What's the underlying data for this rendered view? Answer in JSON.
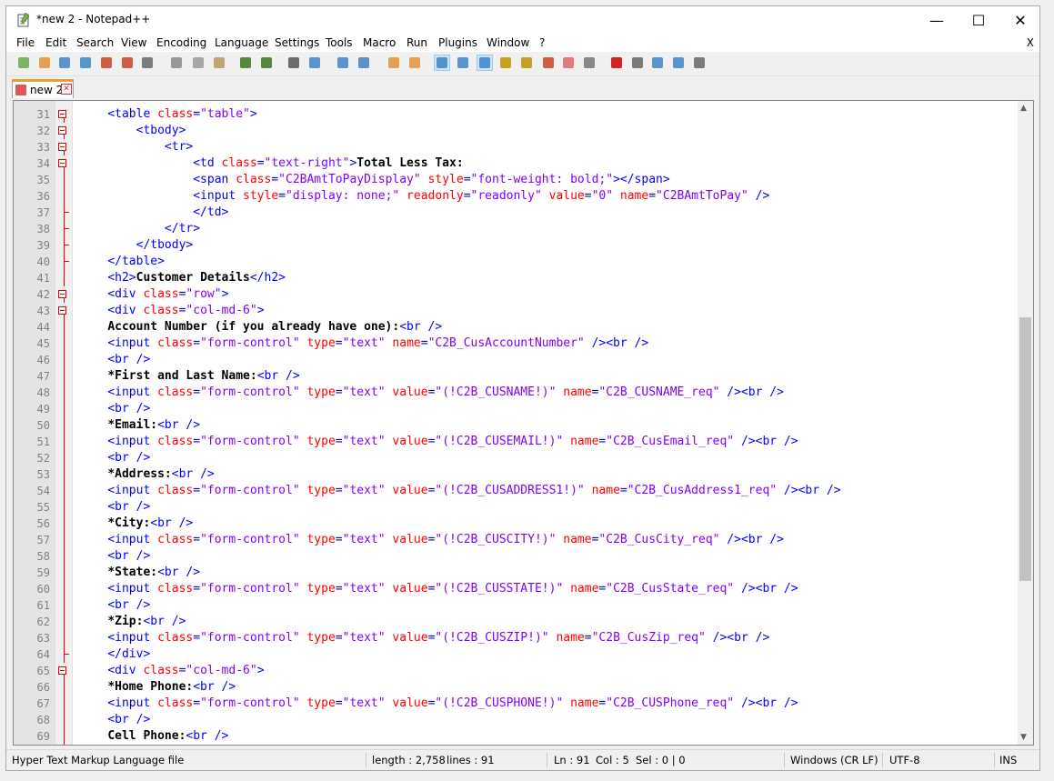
{
  "window": {
    "title": "*new 2 - Notepad++",
    "min_glyph": "—",
    "max_glyph": "☐",
    "close_glyph": "✕"
  },
  "menu": {
    "items": [
      "File",
      "Edit",
      "Search",
      "View",
      "Encoding",
      "Language",
      "Settings",
      "Tools",
      "Macro",
      "Run",
      "Plugins",
      "Window",
      "?"
    ],
    "close_doc": "X"
  },
  "toolbar": {
    "icons": [
      "new-file-icon",
      "open-file-icon",
      "save-icon",
      "save-all-icon",
      "close-icon",
      "close-all-icon",
      "print-icon",
      "cut-icon",
      "copy-icon",
      "paste-icon",
      "undo-icon",
      "redo-icon",
      "find-icon",
      "replace-icon",
      "zoom-in-icon",
      "zoom-out-icon",
      "sync-vertical-icon",
      "sync-horizontal-icon",
      "word-wrap-icon",
      "show-all-chars-icon",
      "indent-guide-icon",
      "language-udl-icon",
      "doc-map-icon",
      "function-list-icon",
      "folder-workspace-icon",
      "monitoring-icon",
      "record-macro-icon",
      "stop-record-icon",
      "play-macro-icon",
      "run-multiple-icon",
      "save-macro-icon"
    ]
  },
  "tab": {
    "label": "new 2"
  },
  "editor": {
    "lines": [
      {
        "n": "31",
        "fold": "box",
        "segs": [
          [
            "    ",
            "p"
          ],
          [
            "<table ",
            "t"
          ],
          [
            "class",
            "a"
          ],
          [
            "=",
            "t"
          ],
          [
            "\"table\"",
            "v"
          ],
          [
            ">",
            "t"
          ]
        ]
      },
      {
        "n": "32",
        "fold": "box",
        "segs": [
          [
            "        ",
            "p"
          ],
          [
            "<tbody>",
            "t"
          ]
        ]
      },
      {
        "n": "33",
        "fold": "box",
        "segs": [
          [
            "            ",
            "p"
          ],
          [
            "<tr>",
            "t"
          ]
        ]
      },
      {
        "n": "34",
        "fold": "box",
        "segs": [
          [
            "                ",
            "p"
          ],
          [
            "<td ",
            "t"
          ],
          [
            "class",
            "a"
          ],
          [
            "=",
            "t"
          ],
          [
            "\"text-right\"",
            "v"
          ],
          [
            ">",
            "t"
          ],
          [
            "Total Less Tax:",
            "b"
          ]
        ]
      },
      {
        "n": "35",
        "fold": "line",
        "segs": [
          [
            "                ",
            "p"
          ],
          [
            "<span ",
            "t"
          ],
          [
            "class",
            "a"
          ],
          [
            "=",
            "t"
          ],
          [
            "\"C2BAmtToPayDisplay\"",
            "v"
          ],
          [
            " style",
            "a"
          ],
          [
            "=",
            "t"
          ],
          [
            "\"font-weight: bold;\"",
            "v"
          ],
          [
            "></span>",
            "t"
          ]
        ]
      },
      {
        "n": "36",
        "fold": "line",
        "segs": [
          [
            "                ",
            "p"
          ],
          [
            "<input ",
            "t"
          ],
          [
            "style",
            "a"
          ],
          [
            "=",
            "t"
          ],
          [
            "\"display: none;\"",
            "v"
          ],
          [
            " readonly",
            "a"
          ],
          [
            "=",
            "t"
          ],
          [
            "\"readonly\"",
            "v"
          ],
          [
            " value",
            "a"
          ],
          [
            "=",
            "t"
          ],
          [
            "\"0\"",
            "v"
          ],
          [
            " name",
            "a"
          ],
          [
            "=",
            "t"
          ],
          [
            "\"C2BAmtToPay\"",
            "v"
          ],
          [
            " />",
            "t"
          ]
        ]
      },
      {
        "n": "37",
        "fold": "end",
        "segs": [
          [
            "                ",
            "p"
          ],
          [
            "</td>",
            "t"
          ]
        ]
      },
      {
        "n": "38",
        "fold": "end",
        "segs": [
          [
            "            ",
            "p"
          ],
          [
            "</tr>",
            "t"
          ]
        ]
      },
      {
        "n": "39",
        "fold": "end",
        "segs": [
          [
            "        ",
            "p"
          ],
          [
            "</tbody>",
            "t"
          ]
        ]
      },
      {
        "n": "40",
        "fold": "end",
        "segs": [
          [
            "    ",
            "p"
          ],
          [
            "</table>",
            "t"
          ]
        ]
      },
      {
        "n": "41",
        "fold": "line",
        "segs": [
          [
            "    ",
            "p"
          ],
          [
            "<h2>",
            "t"
          ],
          [
            "Customer Details",
            "b"
          ],
          [
            "</h2>",
            "t"
          ]
        ]
      },
      {
        "n": "42",
        "fold": "box",
        "segs": [
          [
            "    ",
            "p"
          ],
          [
            "<div ",
            "t"
          ],
          [
            "class",
            "a"
          ],
          [
            "=",
            "t"
          ],
          [
            "\"row\"",
            "v"
          ],
          [
            ">",
            "t"
          ]
        ]
      },
      {
        "n": "43",
        "fold": "box",
        "segs": [
          [
            "    ",
            "p"
          ],
          [
            "<div ",
            "t"
          ],
          [
            "class",
            "a"
          ],
          [
            "=",
            "t"
          ],
          [
            "\"col-md-6\"",
            "v"
          ],
          [
            ">",
            "t"
          ]
        ]
      },
      {
        "n": "44",
        "fold": "line",
        "segs": [
          [
            "    ",
            "p"
          ],
          [
            "Account Number (if you already have one):",
            "b"
          ],
          [
            "<br />",
            "t"
          ]
        ]
      },
      {
        "n": "45",
        "fold": "line",
        "segs": [
          [
            "    ",
            "p"
          ],
          [
            "<input ",
            "t"
          ],
          [
            "class",
            "a"
          ],
          [
            "=",
            "t"
          ],
          [
            "\"form-control\"",
            "v"
          ],
          [
            " type",
            "a"
          ],
          [
            "=",
            "t"
          ],
          [
            "\"text\"",
            "v"
          ],
          [
            " name",
            "a"
          ],
          [
            "=",
            "t"
          ],
          [
            "\"C2B_CusAccountNumber\"",
            "v"
          ],
          [
            " /><br />",
            "t"
          ]
        ]
      },
      {
        "n": "46",
        "fold": "line",
        "segs": [
          [
            "    ",
            "p"
          ],
          [
            "<br />",
            "t"
          ]
        ]
      },
      {
        "n": "47",
        "fold": "line",
        "segs": [
          [
            "    ",
            "p"
          ],
          [
            "*First and Last Name:",
            "b"
          ],
          [
            "<br />",
            "t"
          ]
        ]
      },
      {
        "n": "48",
        "fold": "line",
        "segs": [
          [
            "    ",
            "p"
          ],
          [
            "<input ",
            "t"
          ],
          [
            "class",
            "a"
          ],
          [
            "=",
            "t"
          ],
          [
            "\"form-control\"",
            "v"
          ],
          [
            " type",
            "a"
          ],
          [
            "=",
            "t"
          ],
          [
            "\"text\"",
            "v"
          ],
          [
            " value",
            "a"
          ],
          [
            "=",
            "t"
          ],
          [
            "\"(!C2B_CUSNAME!)\"",
            "v"
          ],
          [
            " name",
            "a"
          ],
          [
            "=",
            "t"
          ],
          [
            "\"C2B_CUSNAME_req\"",
            "v"
          ],
          [
            " /><br />",
            "t"
          ]
        ]
      },
      {
        "n": "49",
        "fold": "line",
        "segs": [
          [
            "    ",
            "p"
          ],
          [
            "<br />",
            "t"
          ]
        ]
      },
      {
        "n": "50",
        "fold": "line",
        "segs": [
          [
            "    ",
            "p"
          ],
          [
            "*Email:",
            "b"
          ],
          [
            "<br />",
            "t"
          ]
        ]
      },
      {
        "n": "51",
        "fold": "line",
        "segs": [
          [
            "    ",
            "p"
          ],
          [
            "<input ",
            "t"
          ],
          [
            "class",
            "a"
          ],
          [
            "=",
            "t"
          ],
          [
            "\"form-control\"",
            "v"
          ],
          [
            " type",
            "a"
          ],
          [
            "=",
            "t"
          ],
          [
            "\"text\"",
            "v"
          ],
          [
            " value",
            "a"
          ],
          [
            "=",
            "t"
          ],
          [
            "\"(!C2B_CUSEMAIL!)\"",
            "v"
          ],
          [
            " name",
            "a"
          ],
          [
            "=",
            "t"
          ],
          [
            "\"C2B_CusEmail_req\"",
            "v"
          ],
          [
            " /><br />",
            "t"
          ]
        ]
      },
      {
        "n": "52",
        "fold": "line",
        "segs": [
          [
            "    ",
            "p"
          ],
          [
            "<br />",
            "t"
          ]
        ]
      },
      {
        "n": "53",
        "fold": "line",
        "segs": [
          [
            "    ",
            "p"
          ],
          [
            "*Address:",
            "b"
          ],
          [
            "<br />",
            "t"
          ]
        ]
      },
      {
        "n": "54",
        "fold": "line",
        "segs": [
          [
            "    ",
            "p"
          ],
          [
            "<input ",
            "t"
          ],
          [
            "class",
            "a"
          ],
          [
            "=",
            "t"
          ],
          [
            "\"form-control\"",
            "v"
          ],
          [
            " type",
            "a"
          ],
          [
            "=",
            "t"
          ],
          [
            "\"text\"",
            "v"
          ],
          [
            " value",
            "a"
          ],
          [
            "=",
            "t"
          ],
          [
            "\"(!C2B_CUSADDRESS1!)\"",
            "v"
          ],
          [
            " name",
            "a"
          ],
          [
            "=",
            "t"
          ],
          [
            "\"C2B_CusAddress1_req\"",
            "v"
          ],
          [
            " /><br />",
            "t"
          ]
        ]
      },
      {
        "n": "55",
        "fold": "line",
        "segs": [
          [
            "    ",
            "p"
          ],
          [
            "<br />",
            "t"
          ]
        ]
      },
      {
        "n": "56",
        "fold": "line",
        "segs": [
          [
            "    ",
            "p"
          ],
          [
            "*City:",
            "b"
          ],
          [
            "<br />",
            "t"
          ]
        ]
      },
      {
        "n": "57",
        "fold": "line",
        "segs": [
          [
            "    ",
            "p"
          ],
          [
            "<input ",
            "t"
          ],
          [
            "class",
            "a"
          ],
          [
            "=",
            "t"
          ],
          [
            "\"form-control\"",
            "v"
          ],
          [
            " type",
            "a"
          ],
          [
            "=",
            "t"
          ],
          [
            "\"text\"",
            "v"
          ],
          [
            " value",
            "a"
          ],
          [
            "=",
            "t"
          ],
          [
            "\"(!C2B_CUSCITY!)\"",
            "v"
          ],
          [
            " name",
            "a"
          ],
          [
            "=",
            "t"
          ],
          [
            "\"C2B_CusCity_req\"",
            "v"
          ],
          [
            " /><br />",
            "t"
          ]
        ]
      },
      {
        "n": "58",
        "fold": "line",
        "segs": [
          [
            "    ",
            "p"
          ],
          [
            "<br />",
            "t"
          ]
        ]
      },
      {
        "n": "59",
        "fold": "line",
        "segs": [
          [
            "    ",
            "p"
          ],
          [
            "*State:",
            "b"
          ],
          [
            "<br />",
            "t"
          ]
        ]
      },
      {
        "n": "60",
        "fold": "line",
        "segs": [
          [
            "    ",
            "p"
          ],
          [
            "<input ",
            "t"
          ],
          [
            "class",
            "a"
          ],
          [
            "=",
            "t"
          ],
          [
            "\"form-control\"",
            "v"
          ],
          [
            " type",
            "a"
          ],
          [
            "=",
            "t"
          ],
          [
            "\"text\"",
            "v"
          ],
          [
            " value",
            "a"
          ],
          [
            "=",
            "t"
          ],
          [
            "\"(!C2B_CUSSTATE!)\"",
            "v"
          ],
          [
            " name",
            "a"
          ],
          [
            "=",
            "t"
          ],
          [
            "\"C2B_CusState_req\"",
            "v"
          ],
          [
            " /><br />",
            "t"
          ]
        ]
      },
      {
        "n": "61",
        "fold": "line",
        "segs": [
          [
            "    ",
            "p"
          ],
          [
            "<br />",
            "t"
          ]
        ]
      },
      {
        "n": "62",
        "fold": "line",
        "segs": [
          [
            "    ",
            "p"
          ],
          [
            "*Zip:",
            "b"
          ],
          [
            "<br />",
            "t"
          ]
        ]
      },
      {
        "n": "63",
        "fold": "line",
        "segs": [
          [
            "    ",
            "p"
          ],
          [
            "<input ",
            "t"
          ],
          [
            "class",
            "a"
          ],
          [
            "=",
            "t"
          ],
          [
            "\"form-control\"",
            "v"
          ],
          [
            " type",
            "a"
          ],
          [
            "=",
            "t"
          ],
          [
            "\"text\"",
            "v"
          ],
          [
            " value",
            "a"
          ],
          [
            "=",
            "t"
          ],
          [
            "\"(!C2B_CUSZIP!)\"",
            "v"
          ],
          [
            " name",
            "a"
          ],
          [
            "=",
            "t"
          ],
          [
            "\"C2B_CusZip_req\"",
            "v"
          ],
          [
            " /><br />",
            "t"
          ]
        ]
      },
      {
        "n": "64",
        "fold": "end",
        "segs": [
          [
            "    ",
            "p"
          ],
          [
            "</div>",
            "t"
          ]
        ]
      },
      {
        "n": "65",
        "fold": "box",
        "segs": [
          [
            "    ",
            "p"
          ],
          [
            "<div ",
            "t"
          ],
          [
            "class",
            "a"
          ],
          [
            "=",
            "t"
          ],
          [
            "\"col-md-6\"",
            "v"
          ],
          [
            ">",
            "t"
          ]
        ]
      },
      {
        "n": "66",
        "fold": "line",
        "segs": [
          [
            "    ",
            "p"
          ],
          [
            "*Home Phone:",
            "b"
          ],
          [
            "<br />",
            "t"
          ]
        ]
      },
      {
        "n": "67",
        "fold": "line",
        "segs": [
          [
            "    ",
            "p"
          ],
          [
            "<input ",
            "t"
          ],
          [
            "class",
            "a"
          ],
          [
            "=",
            "t"
          ],
          [
            "\"form-control\"",
            "v"
          ],
          [
            " type",
            "a"
          ],
          [
            "=",
            "t"
          ],
          [
            "\"text\"",
            "v"
          ],
          [
            " value",
            "a"
          ],
          [
            "=",
            "t"
          ],
          [
            "\"(!C2B_CUSPHONE!)\"",
            "v"
          ],
          [
            " name",
            "a"
          ],
          [
            "=",
            "t"
          ],
          [
            "\"C2B_CUSPhone_req\"",
            "v"
          ],
          [
            " /><br />",
            "t"
          ]
        ]
      },
      {
        "n": "68",
        "fold": "line",
        "segs": [
          [
            "    ",
            "p"
          ],
          [
            "<br />",
            "t"
          ]
        ]
      },
      {
        "n": "69",
        "fold": "line",
        "segs": [
          [
            "    ",
            "p"
          ],
          [
            "Cell Phone:",
            "b"
          ],
          [
            "<br />",
            "t"
          ]
        ]
      }
    ]
  },
  "scroll": {
    "up_glyph": "▲",
    "down_glyph": "▼"
  },
  "status": {
    "filetype": "Hyper Text Markup Language file",
    "length": "length : 2,758",
    "lines": "lines : 91",
    "ln": "Ln : 91",
    "col": "Col : 5",
    "sel": "Sel : 0 | 0",
    "eol": "Windows (CR LF)",
    "encoding": "UTF-8",
    "mode": "INS"
  },
  "colors": {
    "tag": "#0000ff",
    "attr": "#ff0000",
    "value": "#8000ff",
    "fold": "#ff0000",
    "tab_accent": "#f59a2e"
  }
}
